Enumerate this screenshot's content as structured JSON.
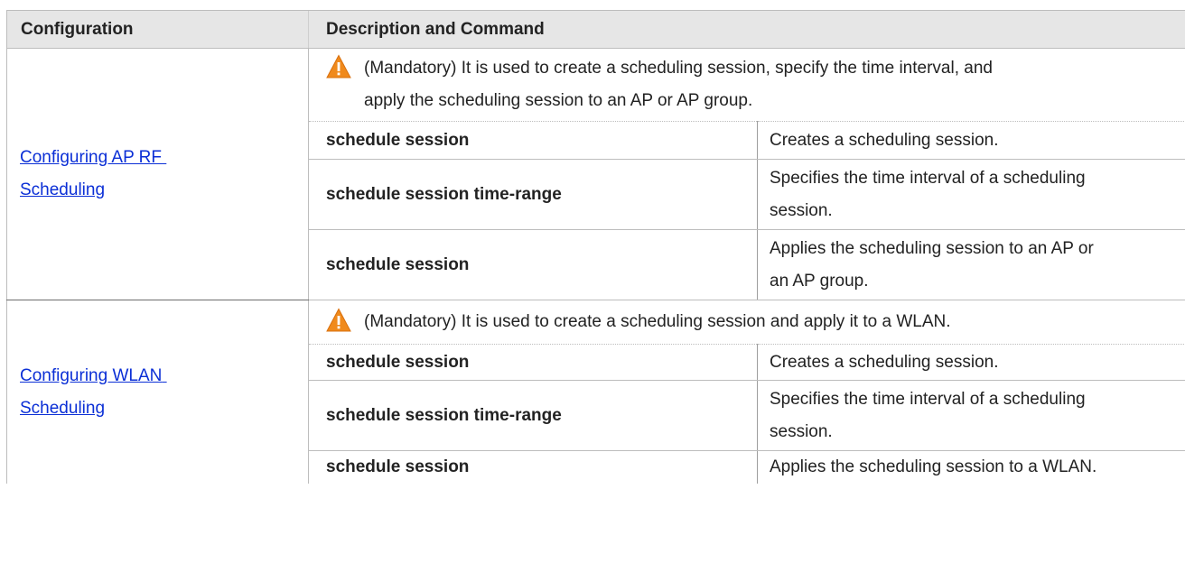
{
  "table": {
    "headers": {
      "configuration": "Configuration",
      "description": "Description and Command"
    },
    "sections": [
      {
        "link_line1": "Configuring AP RF",
        "link_line2": "Scheduling",
        "note_icon": "warning-triangle-icon",
        "note_line1": "(Mandatory) It is used to create a scheduling session, specify the time interval, and",
        "note_line2": "apply the scheduling session to an AP or AP group.",
        "rows": [
          {
            "command": "schedule session",
            "desc_line1": "Creates a scheduling session.",
            "desc_line2": "",
            "desc_line3": ""
          },
          {
            "command": "schedule session time-range",
            "desc_line1": "Specifies the time interval of a scheduling",
            "desc_line2": "session.",
            "desc_line3": ""
          },
          {
            "command": "schedule session",
            "desc_line1": "Applies the scheduling session to an AP or",
            "desc_line2": "an AP group.",
            "desc_line3": ""
          }
        ]
      },
      {
        "link_line1": "Configuring WLAN",
        "link_line2": "Scheduling",
        "note_icon": "warning-triangle-icon",
        "note_line1": "(Mandatory) It is used to create a scheduling session and apply it to a WLAN.",
        "note_line2": "",
        "rows": [
          {
            "command": "schedule session",
            "desc_line1": "Creates a scheduling session.",
            "desc_line2": "",
            "desc_line3": ""
          },
          {
            "command": "schedule session time-range",
            "desc_line1": "Specifies the time interval of a scheduling",
            "desc_line2": "session.",
            "desc_line3": ""
          },
          {
            "command": "schedule session",
            "desc_line1": "Applies the scheduling session to a WLAN.",
            "desc_line2": "",
            "desc_line3": ""
          }
        ]
      }
    ]
  },
  "colors": {
    "header_bg": "#e6e6e6",
    "link": "#0b2fd6",
    "warning_fill": "#f08a1c"
  }
}
